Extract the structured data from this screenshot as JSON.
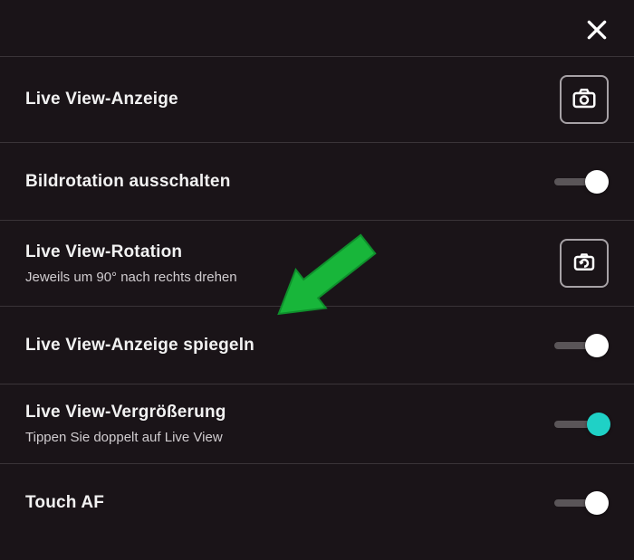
{
  "settings": {
    "items": [
      {
        "title": "Live View-Anzeige",
        "subtitle": ""
      },
      {
        "title": "Bildrotation ausschalten",
        "subtitle": ""
      },
      {
        "title": "Live View-Rotation",
        "subtitle": "Jeweils um 90° nach rechts drehen"
      },
      {
        "title": "Live View-Anzeige spiegeln",
        "subtitle": ""
      },
      {
        "title": "Live View-Vergrößerung",
        "subtitle": "Tippen Sie doppelt auf Live View"
      },
      {
        "title": "Touch AF",
        "subtitle": ""
      }
    ]
  }
}
